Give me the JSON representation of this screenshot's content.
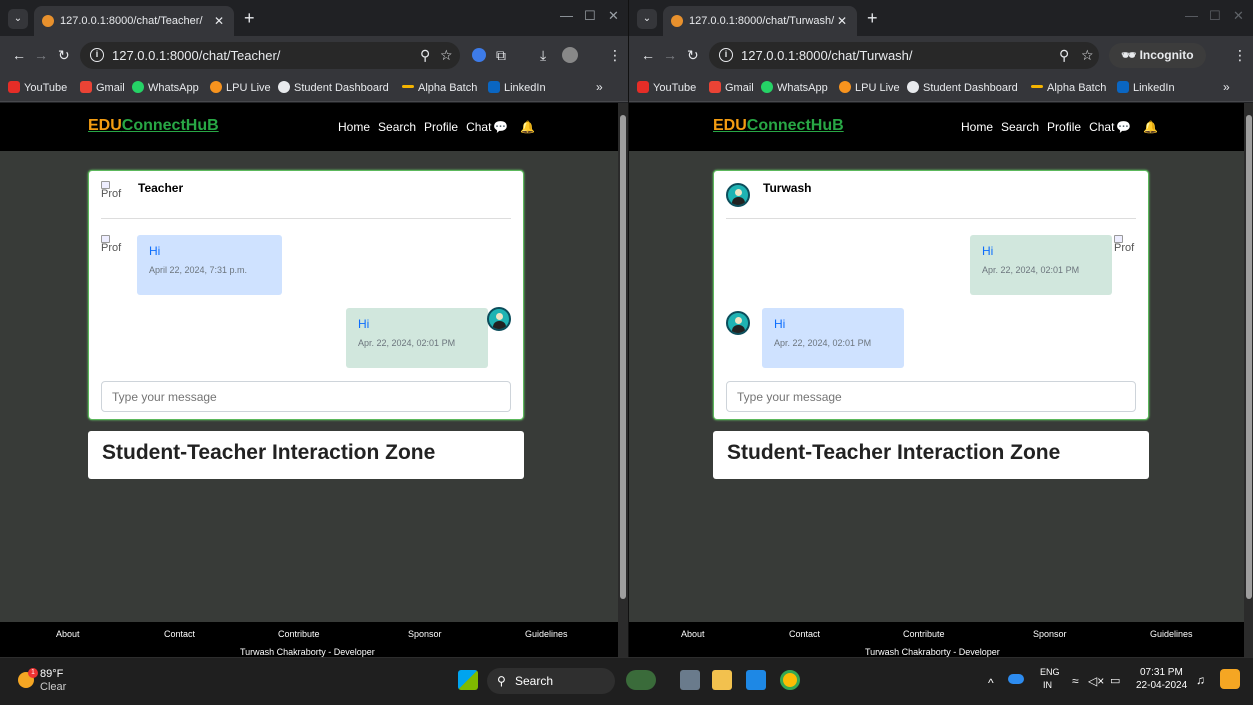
{
  "left": {
    "tab_title": "127.0.0.1:8000/chat/Teacher/",
    "url": "127.0.0.1:8000/chat/Teacher/",
    "chat_header_name": "Teacher",
    "broken_img_alt": "Prof",
    "messages": [
      {
        "text": "Hi",
        "time": "April 22, 2024, 7:31 p.m.",
        "side": "left",
        "color": "blue"
      },
      {
        "text": "Hi",
        "time": "Apr. 22, 2024, 02:01 PM",
        "side": "right",
        "color": "green"
      }
    ]
  },
  "right": {
    "tab_title": "127.0.0.1:8000/chat/Turwash/",
    "url": "127.0.0.1:8000/chat/Turwash/",
    "incognito_label": "Incognito",
    "chat_header_name": "Turwash",
    "broken_img_alt": "Prof",
    "messages": [
      {
        "text": "Hi",
        "time": "Apr. 22, 2024, 02:01 PM",
        "side": "right",
        "color": "green"
      },
      {
        "text": "Hi",
        "time": "Apr. 22, 2024, 02:01 PM",
        "side": "left",
        "color": "blue"
      }
    ]
  },
  "bookmarks": [
    "YouTube",
    "Gmail",
    "WhatsApp",
    "LPU Live",
    "Student Dashboard",
    "Alpha Batch",
    "LinkedIn"
  ],
  "site": {
    "brand_part1": "EDU",
    "brand_part2": "ConnectHuB",
    "nav": [
      "Home",
      "Search",
      "Profile",
      "Chat"
    ],
    "input_placeholder": "Type your message",
    "zone_title": "Student-Teacher Interaction Zone",
    "footer_links": [
      "About",
      "Contact",
      "Contribute",
      "Sponsor",
      "Guidelines"
    ],
    "footer_credit": "Turwash Chakraborty - Developer"
  },
  "taskbar": {
    "weather_temp": "89°F",
    "weather_desc": "Clear",
    "weather_badge": "1",
    "search_label": "Search",
    "lang": "ENG",
    "region": "IN",
    "time": "07:31 PM",
    "date": "22-04-2024"
  },
  "colors": {
    "brand_orange": "#f39c12",
    "brand_green": "#28a745",
    "bubble_blue": "#cfe2ff",
    "bubble_green": "#d1e7dd",
    "page_bg": "#383b38"
  }
}
